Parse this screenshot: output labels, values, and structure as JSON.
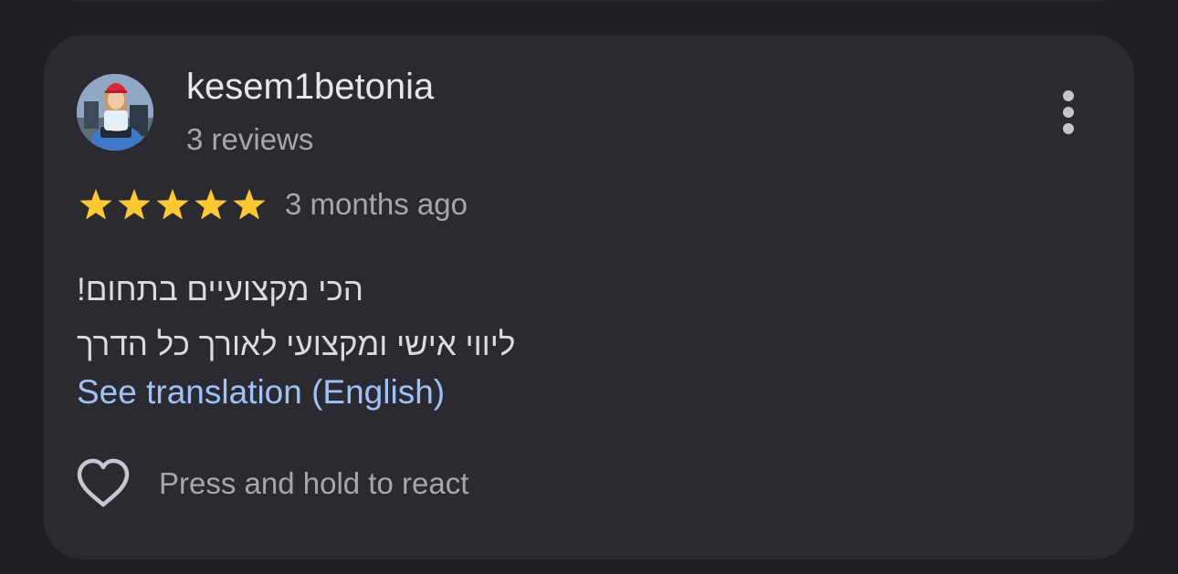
{
  "review": {
    "author_name": "kesem1betonia",
    "author_review_count": "3 reviews",
    "rating": 5,
    "rating_max": 5,
    "time_ago": "3 months ago",
    "text_lines": [
      "הכי מקצועיים בתחום!",
      "ליווי אישי ומקצועי לאורך כל הדרך"
    ],
    "translate_link": "See translation (English)",
    "react_label": "Press and hold to react"
  },
  "icons": {
    "avatar": "profile-photo",
    "more": "more-vertical-icon",
    "star": "star-icon",
    "react": "heart-outline-icon"
  },
  "colors": {
    "background": "#1f1f23",
    "card": "#2b2a30",
    "star": "#fcc934",
    "link": "#9ec2f7",
    "primary_text": "#e8e6ea",
    "secondary_text": "#a8a6ad"
  }
}
